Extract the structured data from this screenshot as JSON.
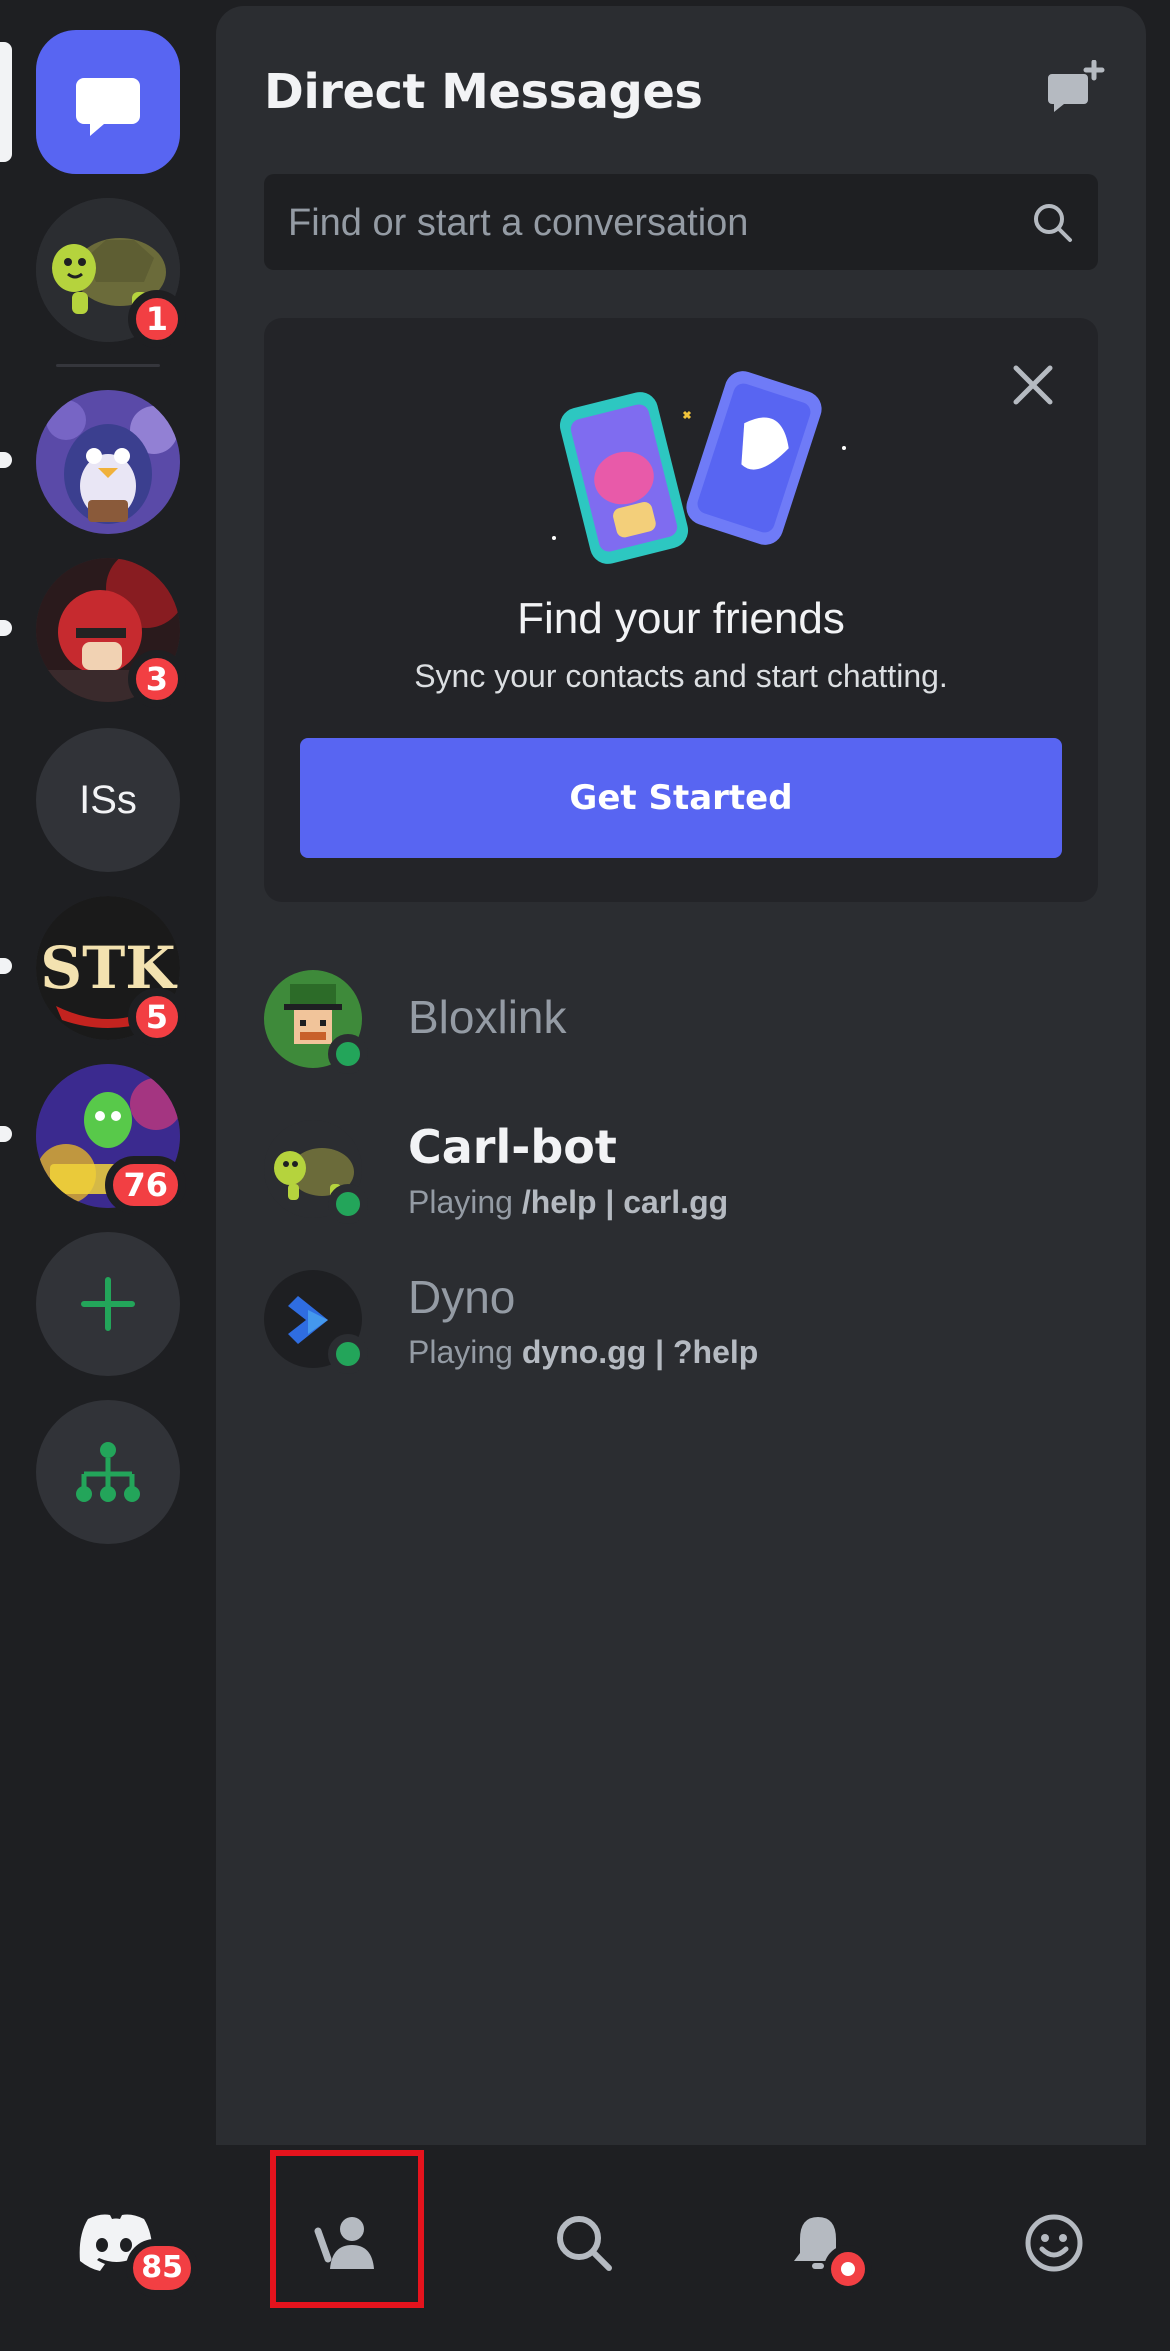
{
  "header": {
    "title": "Direct Messages",
    "new_dm_icon": "new-message-icon"
  },
  "search": {
    "placeholder": "Find or start a conversation"
  },
  "find_friends_card": {
    "title": "Find your friends",
    "subtitle": "Sync your contacts and start chatting.",
    "button_label": "Get Started"
  },
  "servers": [
    {
      "name": "direct-messages",
      "badge": ""
    },
    {
      "name": "turtle-server",
      "badge": "1"
    },
    {
      "name": "penguin-server",
      "badge": ""
    },
    {
      "name": "football-server",
      "badge": "3"
    },
    {
      "name": "isS-server",
      "label": "ISs",
      "badge": ""
    },
    {
      "name": "stk-server",
      "label": "STK",
      "badge": "5"
    },
    {
      "name": "defenders-server",
      "badge": "76"
    }
  ],
  "direct_messages": [
    {
      "name": "Bloxlink",
      "activity_prefix": "",
      "activity_detail": ""
    },
    {
      "name": "Carl-bot",
      "activity_prefix": "Playing ",
      "activity_detail": "/help | carl.gg"
    },
    {
      "name": "Dyno",
      "activity_prefix": "Playing ",
      "activity_detail": "dyno.gg | ?help"
    }
  ],
  "bottom_nav": {
    "home_badge": "85",
    "tabs": [
      "home",
      "friends",
      "search",
      "notifications",
      "profile"
    ]
  },
  "colors": {
    "accent": "#5865f2",
    "online": "#23a55a",
    "badge": "#f23f43"
  }
}
